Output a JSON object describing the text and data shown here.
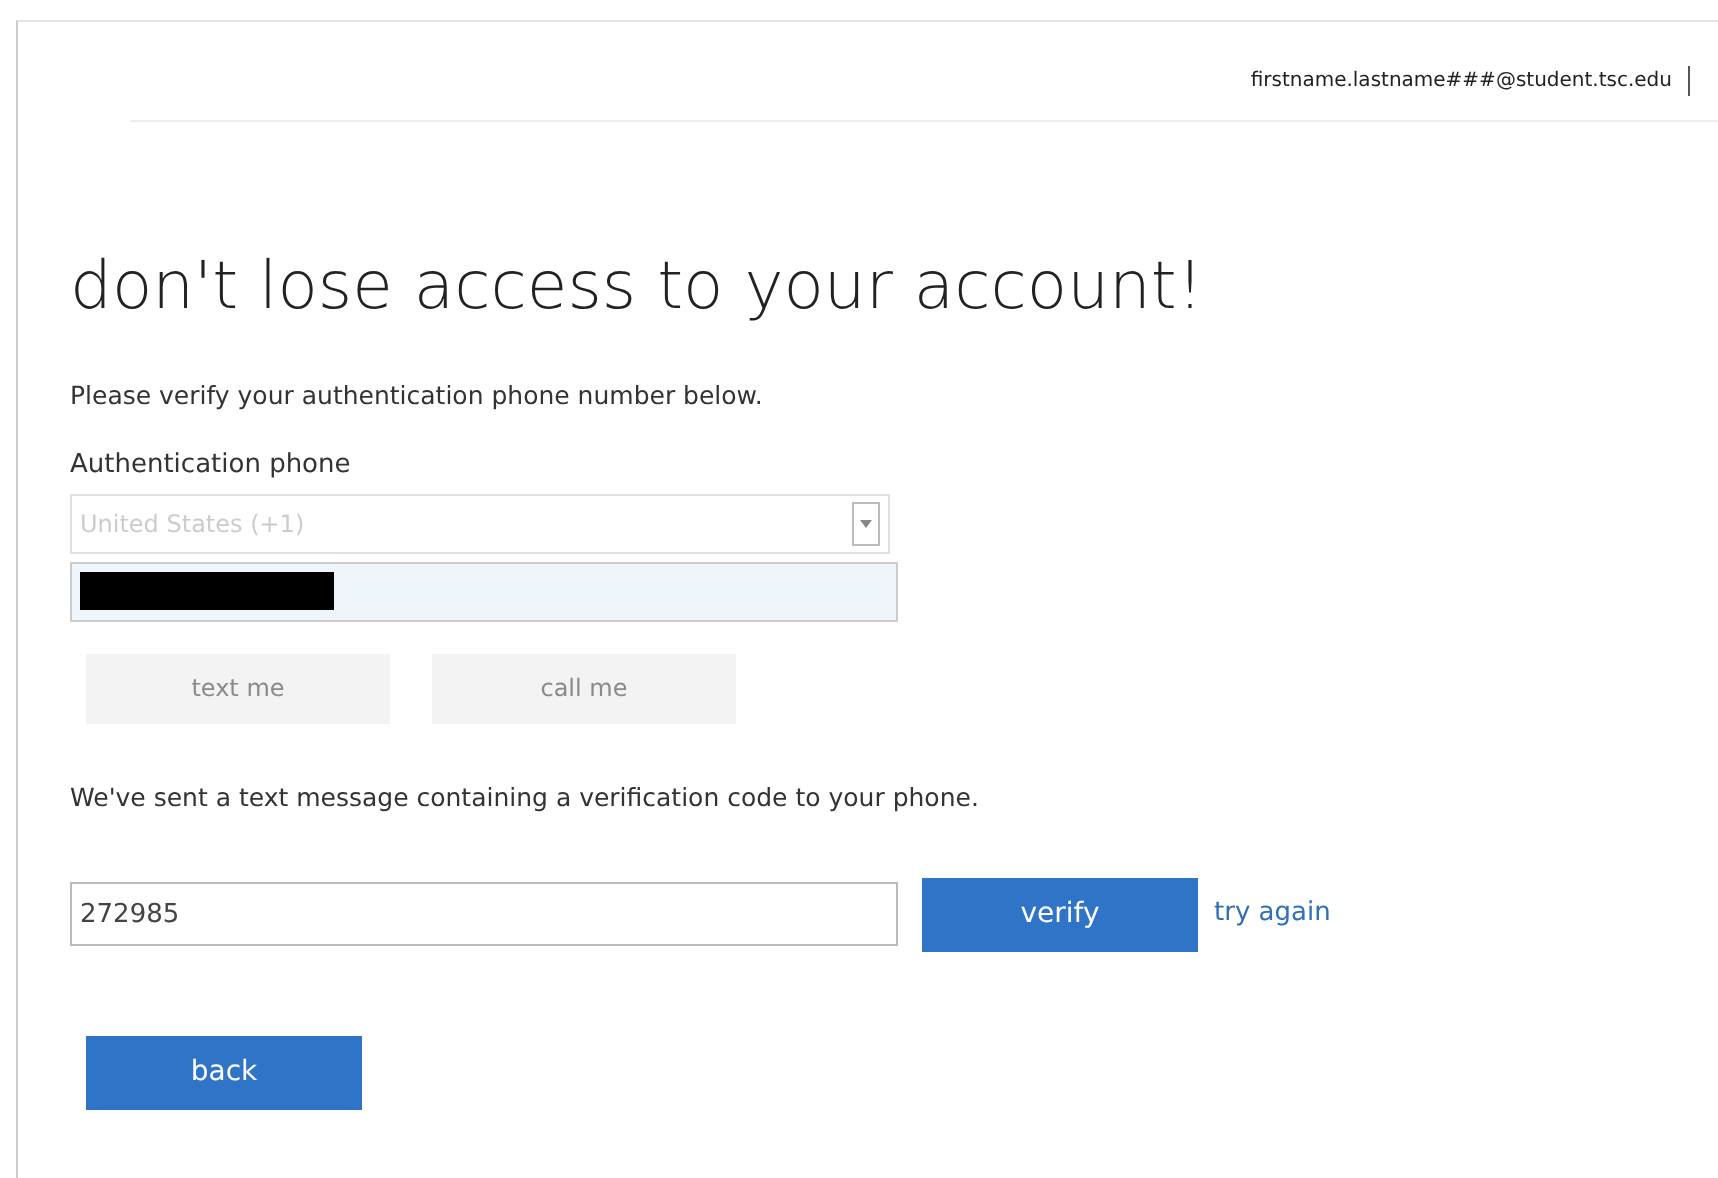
{
  "header": {
    "account": "firstname.lastname###@student.tsc.edu"
  },
  "title": "don't lose access to your account!",
  "instruction": "Please verify your authentication phone number below.",
  "phone_label": "Authentication phone",
  "country_select": {
    "value": "United States (+1)",
    "disabled": true
  },
  "phone_field": {
    "redacted": true
  },
  "contact_buttons": [
    {
      "label": "text me",
      "disabled": true
    },
    {
      "label": "call me",
      "disabled": true
    }
  ],
  "message": "We've sent a text message containing a verification code to your phone.",
  "code_field": {
    "value": "272985"
  },
  "verify_button": "verify",
  "try_again_link": "try again",
  "back_button": "back"
}
